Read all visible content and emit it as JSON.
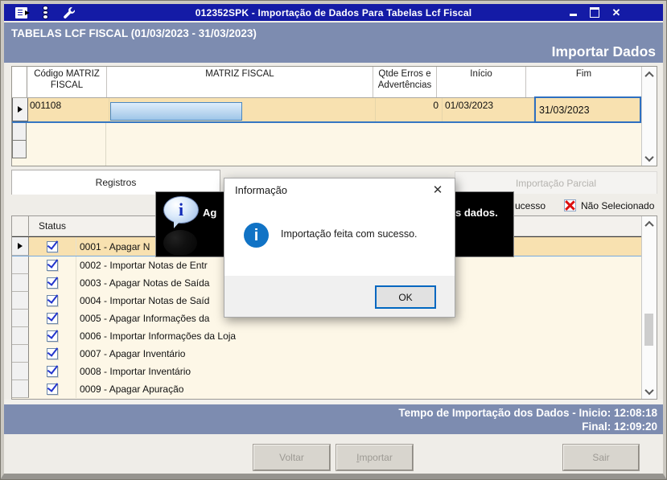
{
  "window": {
    "title": "012352SPK - Importação de Dados Para Tabelas Lcf Fiscal",
    "close_glyph": "✕"
  },
  "header": {
    "title": "TABELAS LCF FISCAL (01/03/2023 - 31/03/2023)",
    "action_title": "Importar Dados"
  },
  "matriz_grid": {
    "columns": [
      "Código MATRIZ FISCAL",
      "MATRIZ FISCAL",
      "Qtde Erros e Advertências",
      "Início",
      "Fim"
    ],
    "rows": [
      {
        "codigo": "001108",
        "matriz": "",
        "qtde": "0",
        "inicio": "01/03/2023",
        "fim": "31/03/2023"
      }
    ]
  },
  "tabs": [
    {
      "label": "Registros",
      "active": true
    },
    {
      "label": "Importação Parcial",
      "disabled": true
    }
  ],
  "legend": {
    "sucesso_fragment": "ucesso",
    "nao_selecionado": "Não Selecionado"
  },
  "checklist": {
    "status_header": "Status",
    "items": [
      {
        "checked": true,
        "selected": true,
        "label": "0001 - Apagar N"
      },
      {
        "checked": true,
        "label": "0002 - Importar Notas de Entr"
      },
      {
        "checked": true,
        "label": "0003 - Apagar Notas de Saída"
      },
      {
        "checked": true,
        "label": "0004 - Importar Notas de Saíd"
      },
      {
        "checked": true,
        "label": "0005 - Apagar Informações da"
      },
      {
        "checked": true,
        "label": "0006 - Importar Informações da Loja"
      },
      {
        "checked": true,
        "label": "0007 - Apagar Inventário"
      },
      {
        "checked": true,
        "label": "0008 - Importar Inventário"
      },
      {
        "checked": true,
        "label": "0009 - Apagar Apuração"
      }
    ]
  },
  "toast": {
    "visible_text_left": "Ag",
    "visible_text_right": "s dados.",
    "icon_letter": "i"
  },
  "dialog": {
    "title": "Informação",
    "message": "Importação feita com sucesso.",
    "ok_label": "OK",
    "close_glyph": "✕",
    "icon_letter": "i"
  },
  "status_bar": {
    "line1": "Tempo de Importação dos Dados - Inicio: 12:08:18",
    "line2": "Final: 12:09:20"
  },
  "actions": {
    "voltar": "Voltar",
    "importar": "Importar",
    "sair": "Sair"
  },
  "icons": {
    "titlebar": [
      "form-icon",
      "traffic-light-icon",
      "wrench-icon"
    ],
    "window_controls": [
      "minimize-icon",
      "maximize-icon",
      "close-icon"
    ],
    "legend": [
      "red-x-icon"
    ],
    "checklist": [
      "checked-checkbox-icon",
      "row-marker-icon"
    ],
    "toast": [
      "info-balloon-icon"
    ],
    "dialog": [
      "info-circle-icon",
      "close-icon"
    ],
    "scrollbars": [
      "scroll-up-icon",
      "scroll-down-icon"
    ]
  },
  "colors": {
    "titlebar_blue": "#141ba6",
    "band_slate": "#7d8cb0",
    "row_highlight_tan": "#f8e1b0",
    "panel_cream": "#fdf7e7",
    "dialog_info_blue": "#1173c5",
    "check_blue": "#2335cc",
    "error_red": "#dc1010",
    "focus_border_blue": "#2e6fc0",
    "disabled_text": "#9d9a94"
  }
}
